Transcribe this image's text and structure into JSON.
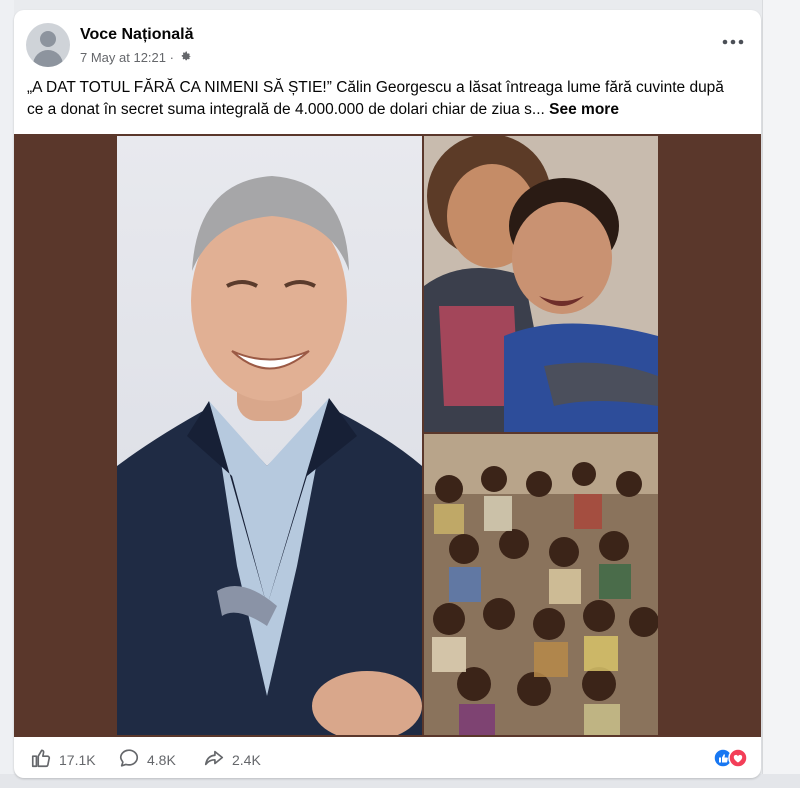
{
  "post": {
    "page_name": "Voce Națională",
    "timestamp": "7 May at 12:21 ·",
    "audience_icon": "gear-icon",
    "caption_line1": "„A DAT TOTUL FĂRĂ CA NIMENI SĂ ȘTIE!” Călin Georgescu a lăsat întreaga lume fără cuvinte după",
    "caption_line2": "ce a donat în secret suma integrală de 4.000.000 de dolari chiar de ziua s...",
    "see_more": "See more",
    "more_icon": "more-options-icon"
  },
  "media": {
    "photos": [
      {
        "subject": "man-portrait"
      },
      {
        "subject": "crying-children"
      },
      {
        "subject": "group-of-children"
      }
    ],
    "background_color": "#5a372b"
  },
  "footer": {
    "likes": "17.1K",
    "comments": "4.8K",
    "shares": "2.4K",
    "like_icon": "like-icon",
    "comment_icon": "comment-icon",
    "share_icon": "share-icon",
    "reaction_icons": [
      "like-reaction-icon",
      "love-reaction-icon"
    ]
  },
  "colors": {
    "like_blue": "#1877f2",
    "love_red": "#f33e58",
    "text_secondary": "#65676b"
  }
}
